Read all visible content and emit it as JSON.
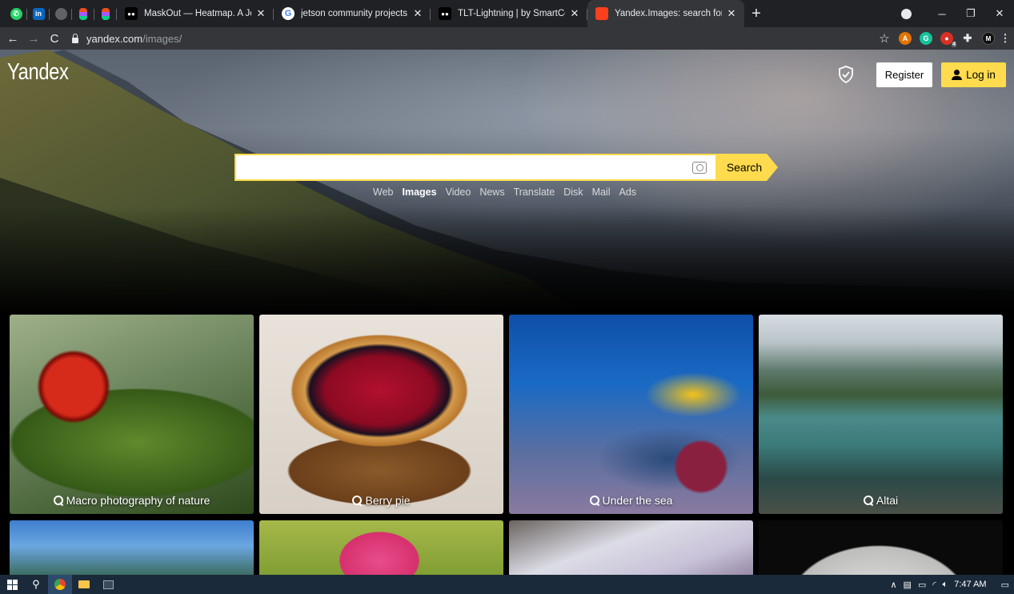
{
  "browser": {
    "tabs": [
      {
        "title": "MaskOut — Heatmap. A Jetson U",
        "favicon": "medium-icon",
        "active": false
      },
      {
        "title": "jetson community projects - Goo",
        "favicon": "google-icon",
        "active": false
      },
      {
        "title": "TLT-Lightning | by SmartCow | M",
        "favicon": "medium-icon",
        "active": false
      },
      {
        "title": "Yandex.Images: search for image",
        "favicon": "yandex-images-icon",
        "active": true
      }
    ],
    "pinned": [
      "whatsapp-icon",
      "linkedin-icon",
      "chrome-icon",
      "figma-icon",
      "figma-icon"
    ],
    "url_host": "yandex.com",
    "url_path": "/images/",
    "extension_badge": "4"
  },
  "header": {
    "logo": "Yandex",
    "register_label": "Register",
    "login_label": "Log in"
  },
  "search": {
    "value": "",
    "button_label": "Search"
  },
  "services": [
    {
      "label": "Web",
      "active": false
    },
    {
      "label": "Images",
      "active": true
    },
    {
      "label": "Video",
      "active": false
    },
    {
      "label": "News",
      "active": false
    },
    {
      "label": "Translate",
      "active": false
    },
    {
      "label": "Disk",
      "active": false
    },
    {
      "label": "Mail",
      "active": false
    },
    {
      "label": "Ads",
      "active": false
    }
  ],
  "tiles": [
    {
      "caption": "Macro photography of nature"
    },
    {
      "caption": "Berry pie"
    },
    {
      "caption": "Under the sea"
    },
    {
      "caption": "Altai"
    }
  ],
  "taskbar": {
    "time": "7:47 AM"
  },
  "colors": {
    "accent": "#ffdb4d",
    "chrome_dark": "#202124",
    "chrome_toolbar": "#35363a"
  }
}
